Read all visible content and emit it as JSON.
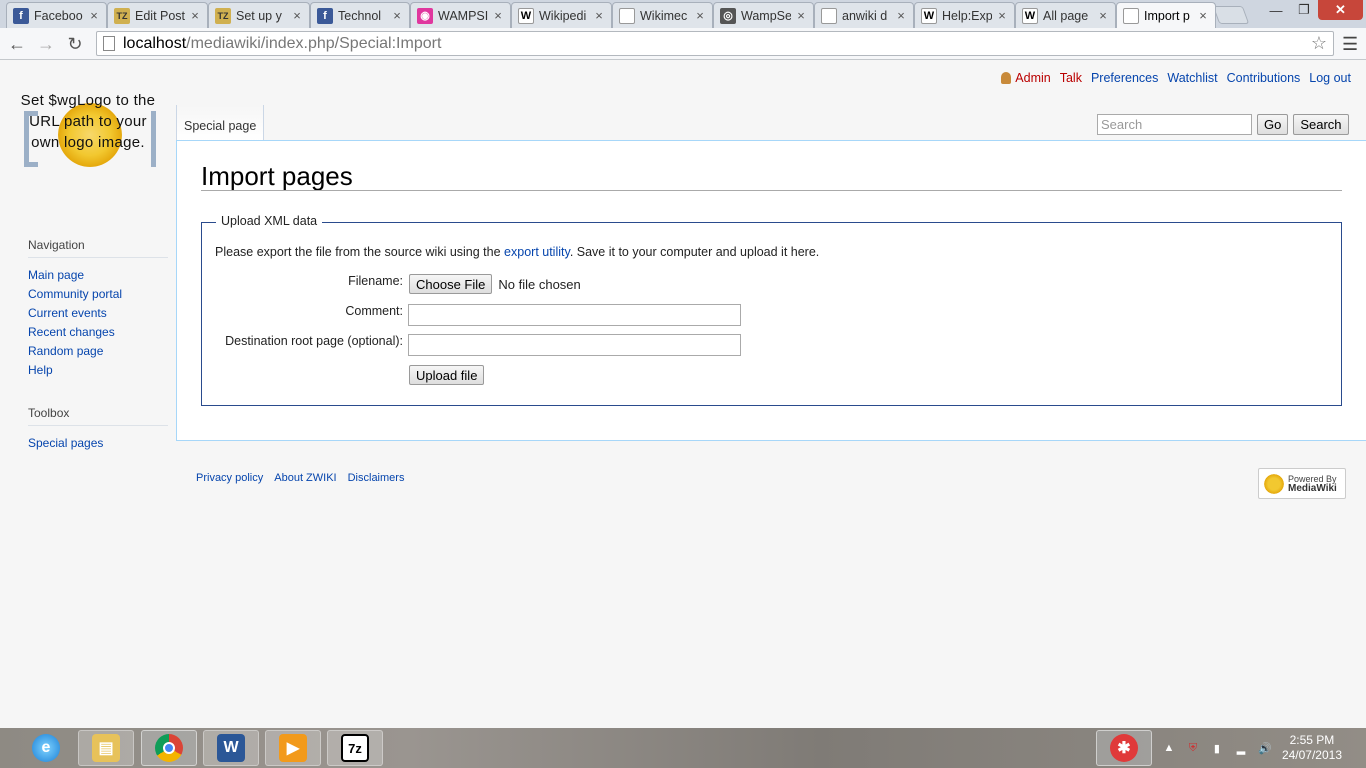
{
  "browser": {
    "tabs": [
      {
        "label": "Faceboo",
        "icon": "facebook-icon",
        "icon_char": "f",
        "icon_color": "#3b5998"
      },
      {
        "label": "Edit Post",
        "icon": "tz-icon",
        "icon_char": "TZ",
        "icon_color": "#d0b050"
      },
      {
        "label": "Set up y",
        "icon": "tz-icon",
        "icon_char": "TZ",
        "icon_color": "#d0b050"
      },
      {
        "label": "Technol",
        "icon": "facebook-icon",
        "icon_char": "f",
        "icon_color": "#3b5998"
      },
      {
        "label": "WAMPSI",
        "icon": "wamp-icon",
        "icon_char": "◉",
        "icon_color": "#e0379e"
      },
      {
        "label": "Wikipedi",
        "icon": "wikipedia-icon",
        "icon_char": "W",
        "icon_color": "#ffffff"
      },
      {
        "label": "Wikimec",
        "icon": "page-icon",
        "icon_char": "",
        "icon_color": "#ffffff"
      },
      {
        "label": "WampSe",
        "icon": "wampserver-icon",
        "icon_char": "◎",
        "icon_color": "#555555"
      },
      {
        "label": "anwiki d",
        "icon": "page-icon",
        "icon_char": "",
        "icon_color": "#ffffff"
      },
      {
        "label": "Help:Exp",
        "icon": "wikipedia-icon",
        "icon_char": "W",
        "icon_color": "#ffffff"
      },
      {
        "label": "All page",
        "icon": "wikipedia-icon",
        "icon_char": "W",
        "icon_color": "#ffffff"
      },
      {
        "label": "Import p",
        "icon": "page-icon",
        "icon_char": "",
        "icon_color": "#ffffff",
        "active": true
      }
    ],
    "url_host": "localhost",
    "url_path": "/mediawiki/index.php/Special:Import"
  },
  "personal": {
    "user": "Admin",
    "talk": "Talk",
    "preferences": "Preferences",
    "watchlist": "Watchlist",
    "contributions": "Contributions",
    "logout": "Log out"
  },
  "logo": {
    "text": "Set $wgLogo to the URL path to your own logo image."
  },
  "sidebar": {
    "navigation_title": "Navigation",
    "navigation": [
      "Main page",
      "Community portal",
      "Current events",
      "Recent changes",
      "Random page",
      "Help"
    ],
    "toolbox_title": "Toolbox",
    "toolbox": [
      "Special pages"
    ]
  },
  "tabs": {
    "special": "Special page"
  },
  "search": {
    "placeholder": "Search",
    "go": "Go",
    "search": "Search"
  },
  "content": {
    "title": "Import pages",
    "legend": "Upload XML data",
    "intro_before": "Please export the file from the source wiki using the ",
    "intro_link": "export utility",
    "intro_after": ". Save it to your computer and upload it here.",
    "filename_label": "Filename:",
    "choose_file": "Choose File",
    "no_file": "No file chosen",
    "comment_label": "Comment:",
    "comment_value": "",
    "dest_label": "Destination root page (optional):",
    "dest_value": "",
    "upload_button": "Upload file"
  },
  "footer": {
    "privacy": "Privacy policy",
    "about": "About ZWIKI",
    "disclaimers": "Disclaimers",
    "powered_line1": "Powered By",
    "powered_line2": "MediaWiki"
  },
  "taskbar": {
    "time": "2:55 PM",
    "date": "24/07/2013"
  }
}
